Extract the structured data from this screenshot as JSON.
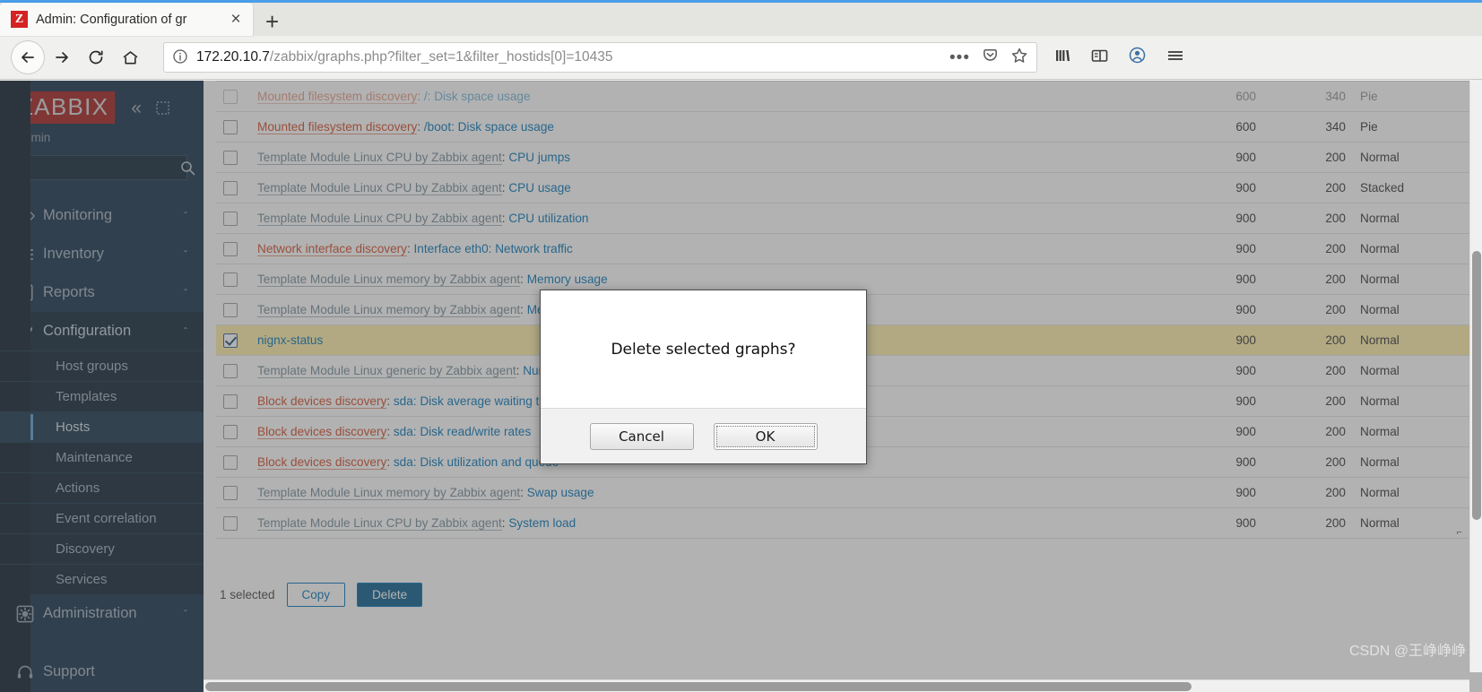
{
  "browser": {
    "tab": {
      "title": "Admin: Configuration of gr",
      "favicon_letter": "Z",
      "close_label": "×"
    },
    "new_tab_label": "+",
    "nav": {
      "back": "back-button",
      "forward": "forward-button",
      "reload": "reload-button",
      "home": "home-button"
    },
    "url": {
      "host": "172.20.10.7",
      "path": "/zabbix/graphs.php?filter_set=1&filter_hostids[0]=10435",
      "page_actions_label": "•••"
    }
  },
  "sidebar": {
    "logo": "ZABBIX",
    "collapse_label": "«",
    "user": "Admin",
    "search_placeholder": "",
    "search_value": "",
    "menu": [
      {
        "label": "Monitoring",
        "icon": "eye-icon",
        "chevron": "ˇ"
      },
      {
        "label": "Inventory",
        "icon": "list-icon",
        "chevron": "ˇ"
      },
      {
        "label": "Reports",
        "icon": "bar-chart-icon",
        "chevron": "ˇ"
      },
      {
        "label": "Configuration",
        "icon": "wrench-icon",
        "chevron": "ˆ"
      }
    ],
    "submenu": [
      {
        "label": "Host groups"
      },
      {
        "label": "Templates"
      },
      {
        "label": "Hosts"
      },
      {
        "label": "Maintenance"
      },
      {
        "label": "Actions"
      },
      {
        "label": "Event correlation"
      },
      {
        "label": "Discovery"
      },
      {
        "label": "Services"
      }
    ],
    "current_submenu": "Hosts",
    "admin": {
      "label": "Administration",
      "icon": "gear-icon",
      "chevron": "ˇ"
    },
    "support": {
      "label": "Support",
      "icon": "headset-icon"
    }
  },
  "table": {
    "rows": [
      {
        "prefix": "Mounted filesystem discovery",
        "prefix_type": "red",
        "name": "/: Disk space usage",
        "width": "600",
        "height": "340",
        "type": "Pie",
        "selected": false,
        "partial": true
      },
      {
        "prefix": "Mounted filesystem discovery",
        "prefix_type": "red",
        "name": "/boot: Disk space usage",
        "width": "600",
        "height": "340",
        "type": "Pie",
        "selected": false
      },
      {
        "prefix": "Template Module Linux CPU by Zabbix agent",
        "prefix_type": "gray",
        "name": "CPU jumps",
        "width": "900",
        "height": "200",
        "type": "Normal",
        "selected": false
      },
      {
        "prefix": "Template Module Linux CPU by Zabbix agent",
        "prefix_type": "gray",
        "name": "CPU usage",
        "width": "900",
        "height": "200",
        "type": "Stacked",
        "selected": false
      },
      {
        "prefix": "Template Module Linux CPU by Zabbix agent",
        "prefix_type": "gray",
        "name": "CPU utilization",
        "width": "900",
        "height": "200",
        "type": "Normal",
        "selected": false
      },
      {
        "prefix": "Network interface discovery",
        "prefix_type": "red",
        "name": "Interface eth0: Network traffic",
        "width": "900",
        "height": "200",
        "type": "Normal",
        "selected": false
      },
      {
        "prefix": "Template Module Linux memory by Zabbix agent",
        "prefix_type": "gray",
        "name": "Memory usage",
        "width": "900",
        "height": "200",
        "type": "Normal",
        "selected": false
      },
      {
        "prefix": "Template Module Linux memory by Zabbix agent",
        "prefix_type": "gray",
        "name": "Memory utilization",
        "width": "900",
        "height": "200",
        "type": "Normal",
        "selected": false
      },
      {
        "prefix": "",
        "prefix_type": "none",
        "name": "nignx-status",
        "width": "900",
        "height": "200",
        "type": "Normal",
        "selected": true
      },
      {
        "prefix": "Template Module Linux generic by Zabbix agent",
        "prefix_type": "gray",
        "name": "Number of processes",
        "width": "900",
        "height": "200",
        "type": "Normal",
        "selected": false
      },
      {
        "prefix": "Block devices discovery",
        "prefix_type": "red",
        "name": "sda: Disk average waiting time",
        "width": "900",
        "height": "200",
        "type": "Normal",
        "selected": false
      },
      {
        "prefix": "Block devices discovery",
        "prefix_type": "red",
        "name": "sda: Disk read/write rates",
        "width": "900",
        "height": "200",
        "type": "Normal",
        "selected": false
      },
      {
        "prefix": "Block devices discovery",
        "prefix_type": "red",
        "name": "sda: Disk utilization and queue",
        "width": "900",
        "height": "200",
        "type": "Normal",
        "selected": false
      },
      {
        "prefix": "Template Module Linux memory by Zabbix agent",
        "prefix_type": "gray",
        "name": "Swap usage",
        "width": "900",
        "height": "200",
        "type": "Normal",
        "selected": false
      },
      {
        "prefix": "Template Module Linux CPU by Zabbix agent",
        "prefix_type": "gray",
        "name": "System load",
        "width": "900",
        "height": "200",
        "type": "Normal",
        "selected": false
      }
    ]
  },
  "footer": {
    "selected_text": "1 selected",
    "copy_label": "Copy",
    "delete_label": "Delete"
  },
  "dialog": {
    "message": "Delete selected graphs?",
    "cancel_label": "Cancel",
    "ok_label": "OK"
  },
  "watermark": "CSDN @王峥峥峥",
  "colors": {
    "zabbix_red": "#a61e1e",
    "sidebar_bg": "#15314a",
    "link_blue": "#0275b8",
    "discovery_red": "#d24b28",
    "selected_row": "#ffeeaa",
    "accent_blue": "#0a5e8c"
  }
}
